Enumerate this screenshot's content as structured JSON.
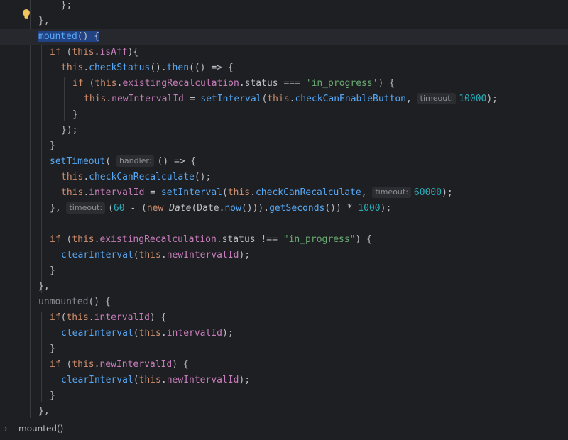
{
  "editor": {
    "lines": [
      [
        {
          "t": "  };",
          "c": "pl"
        }
      ],
      [
        {
          "t": "},",
          "c": "pl"
        }
      ],
      [
        {
          "t": "mounted",
          "c": "fn sel"
        },
        {
          "t": "() {",
          "c": "pl sel"
        }
      ],
      [
        {
          "t": "if",
          "c": "kw"
        },
        {
          "t": " (",
          "c": "pl"
        },
        {
          "t": "this",
          "c": "kw"
        },
        {
          "t": ".",
          "c": "pl"
        },
        {
          "t": "isAff",
          "c": "prop"
        },
        {
          "t": "){",
          "c": "pl"
        }
      ],
      [
        {
          "t": "this",
          "c": "kw"
        },
        {
          "t": ".",
          "c": "pl"
        },
        {
          "t": "checkStatus",
          "c": "fn"
        },
        {
          "t": "().",
          "c": "pl"
        },
        {
          "t": "then",
          "c": "fn"
        },
        {
          "t": "(() => {",
          "c": "pl"
        }
      ],
      [
        {
          "t": "if",
          "c": "kw"
        },
        {
          "t": " (",
          "c": "pl"
        },
        {
          "t": "this",
          "c": "kw"
        },
        {
          "t": ".",
          "c": "pl"
        },
        {
          "t": "existingRecalculation",
          "c": "prop"
        },
        {
          "t": ".status === ",
          "c": "pl"
        },
        {
          "t": "'in_progress'",
          "c": "str"
        },
        {
          "t": ") {",
          "c": "pl"
        }
      ],
      [
        {
          "t": "this",
          "c": "kw"
        },
        {
          "t": ".",
          "c": "pl"
        },
        {
          "t": "newIntervalId",
          "c": "prop"
        },
        {
          "t": " = ",
          "c": "pl"
        },
        {
          "t": "setInterval",
          "c": "fn"
        },
        {
          "t": "(",
          "c": "pl"
        },
        {
          "t": "this",
          "c": "kw"
        },
        {
          "t": ".",
          "c": "pl"
        },
        {
          "t": "checkCanEnableButton",
          "c": "fn"
        },
        {
          "t": ", ",
          "c": "pl"
        },
        {
          "h": "timeout:"
        },
        {
          "t": "10000",
          "c": "num"
        },
        {
          "t": ");",
          "c": "pl"
        }
      ],
      [
        {
          "t": "}",
          "c": "pl"
        }
      ],
      [
        {
          "t": "});",
          "c": "pl"
        }
      ],
      [
        {
          "t": "}",
          "c": "pl"
        }
      ],
      [
        {
          "t": "setTimeout",
          "c": "fn"
        },
        {
          "t": "( ",
          "c": "pl"
        },
        {
          "h": "handler:"
        },
        {
          "t": "() => {",
          "c": "pl"
        }
      ],
      [
        {
          "t": "this",
          "c": "kw"
        },
        {
          "t": ".",
          "c": "pl"
        },
        {
          "t": "checkCanRecalculate",
          "c": "fn"
        },
        {
          "t": "();",
          "c": "pl"
        }
      ],
      [
        {
          "t": "this",
          "c": "kw"
        },
        {
          "t": ".",
          "c": "pl"
        },
        {
          "t": "intervalId",
          "c": "prop"
        },
        {
          "t": " = ",
          "c": "pl"
        },
        {
          "t": "setInterval",
          "c": "fn"
        },
        {
          "t": "(",
          "c": "pl"
        },
        {
          "t": "this",
          "c": "kw"
        },
        {
          "t": ".",
          "c": "pl"
        },
        {
          "t": "checkCanRecalculate",
          "c": "fn"
        },
        {
          "t": ", ",
          "c": "pl"
        },
        {
          "h": "timeout:"
        },
        {
          "t": "60000",
          "c": "num"
        },
        {
          "t": ");",
          "c": "pl"
        }
      ],
      [
        {
          "t": "}, ",
          "c": "pl"
        },
        {
          "h": "timeout:"
        },
        {
          "t": "(",
          "c": "pl"
        },
        {
          "t": "60",
          "c": "num"
        },
        {
          "t": " - (",
          "c": "pl"
        },
        {
          "t": "new ",
          "c": "kw"
        },
        {
          "t": "Date",
          "c": "it"
        },
        {
          "t": "(Date.",
          "c": "pl"
        },
        {
          "t": "now",
          "c": "fn"
        },
        {
          "t": "())).",
          "c": "pl"
        },
        {
          "t": "getSeconds",
          "c": "fn"
        },
        {
          "t": "()) * ",
          "c": "pl"
        },
        {
          "t": "1000",
          "c": "num"
        },
        {
          "t": ");",
          "c": "pl"
        }
      ],
      [],
      [
        {
          "t": "if",
          "c": "kw"
        },
        {
          "t": " (",
          "c": "pl"
        },
        {
          "t": "this",
          "c": "kw"
        },
        {
          "t": ".",
          "c": "pl"
        },
        {
          "t": "existingRecalculation",
          "c": "prop"
        },
        {
          "t": ".status !== ",
          "c": "pl"
        },
        {
          "t": "\"in_progress\"",
          "c": "str"
        },
        {
          "t": ") {",
          "c": "pl"
        }
      ],
      [
        {
          "t": "clearInterval",
          "c": "fn"
        },
        {
          "t": "(",
          "c": "pl"
        },
        {
          "t": "this",
          "c": "kw"
        },
        {
          "t": ".",
          "c": "pl"
        },
        {
          "t": "newIntervalId",
          "c": "prop"
        },
        {
          "t": ");",
          "c": "pl"
        }
      ],
      [
        {
          "t": "}",
          "c": "pl"
        }
      ],
      [
        {
          "t": "},",
          "c": "pl"
        }
      ],
      [
        {
          "t": "unmounted",
          "c": "dim"
        },
        {
          "t": "() {",
          "c": "pl"
        }
      ],
      [
        {
          "t": "if",
          "c": "kw"
        },
        {
          "t": "(",
          "c": "pl"
        },
        {
          "t": "this",
          "c": "kw"
        },
        {
          "t": ".",
          "c": "pl"
        },
        {
          "t": "intervalId",
          "c": "prop"
        },
        {
          "t": ") {",
          "c": "pl"
        }
      ],
      [
        {
          "t": "clearInterval",
          "c": "fn"
        },
        {
          "t": "(",
          "c": "pl"
        },
        {
          "t": "this",
          "c": "kw"
        },
        {
          "t": ".",
          "c": "pl"
        },
        {
          "t": "intervalId",
          "c": "prop"
        },
        {
          "t": ");",
          "c": "pl"
        }
      ],
      [
        {
          "t": "}",
          "c": "pl"
        }
      ],
      [
        {
          "t": "if",
          "c": "kw"
        },
        {
          "t": " (",
          "c": "pl"
        },
        {
          "t": "this",
          "c": "kw"
        },
        {
          "t": ".",
          "c": "pl"
        },
        {
          "t": "newIntervalId",
          "c": "prop"
        },
        {
          "t": ") {",
          "c": "pl"
        }
      ],
      [
        {
          "t": "clearInterval",
          "c": "fn"
        },
        {
          "t": "(",
          "c": "pl"
        },
        {
          "t": "this",
          "c": "kw"
        },
        {
          "t": ".",
          "c": "pl"
        },
        {
          "t": "newIntervalId",
          "c": "prop"
        },
        {
          "t": ");",
          "c": "pl"
        }
      ],
      [
        {
          "t": "}",
          "c": "pl"
        }
      ],
      [
        {
          "t": "},",
          "c": "pl"
        }
      ]
    ]
  },
  "breadcrumb": {
    "chevron_icon": "chevron-right-icon",
    "label": "mounted()"
  },
  "gutter": {
    "intention_icon": "lightbulb-icon"
  },
  "colors": {
    "background": "#1e1f22",
    "keyword": "#cf8e6d",
    "function": "#56a8f5",
    "property": "#c77dbb",
    "string": "#6aab73",
    "number": "#2aacb8",
    "selection": "#214283"
  }
}
